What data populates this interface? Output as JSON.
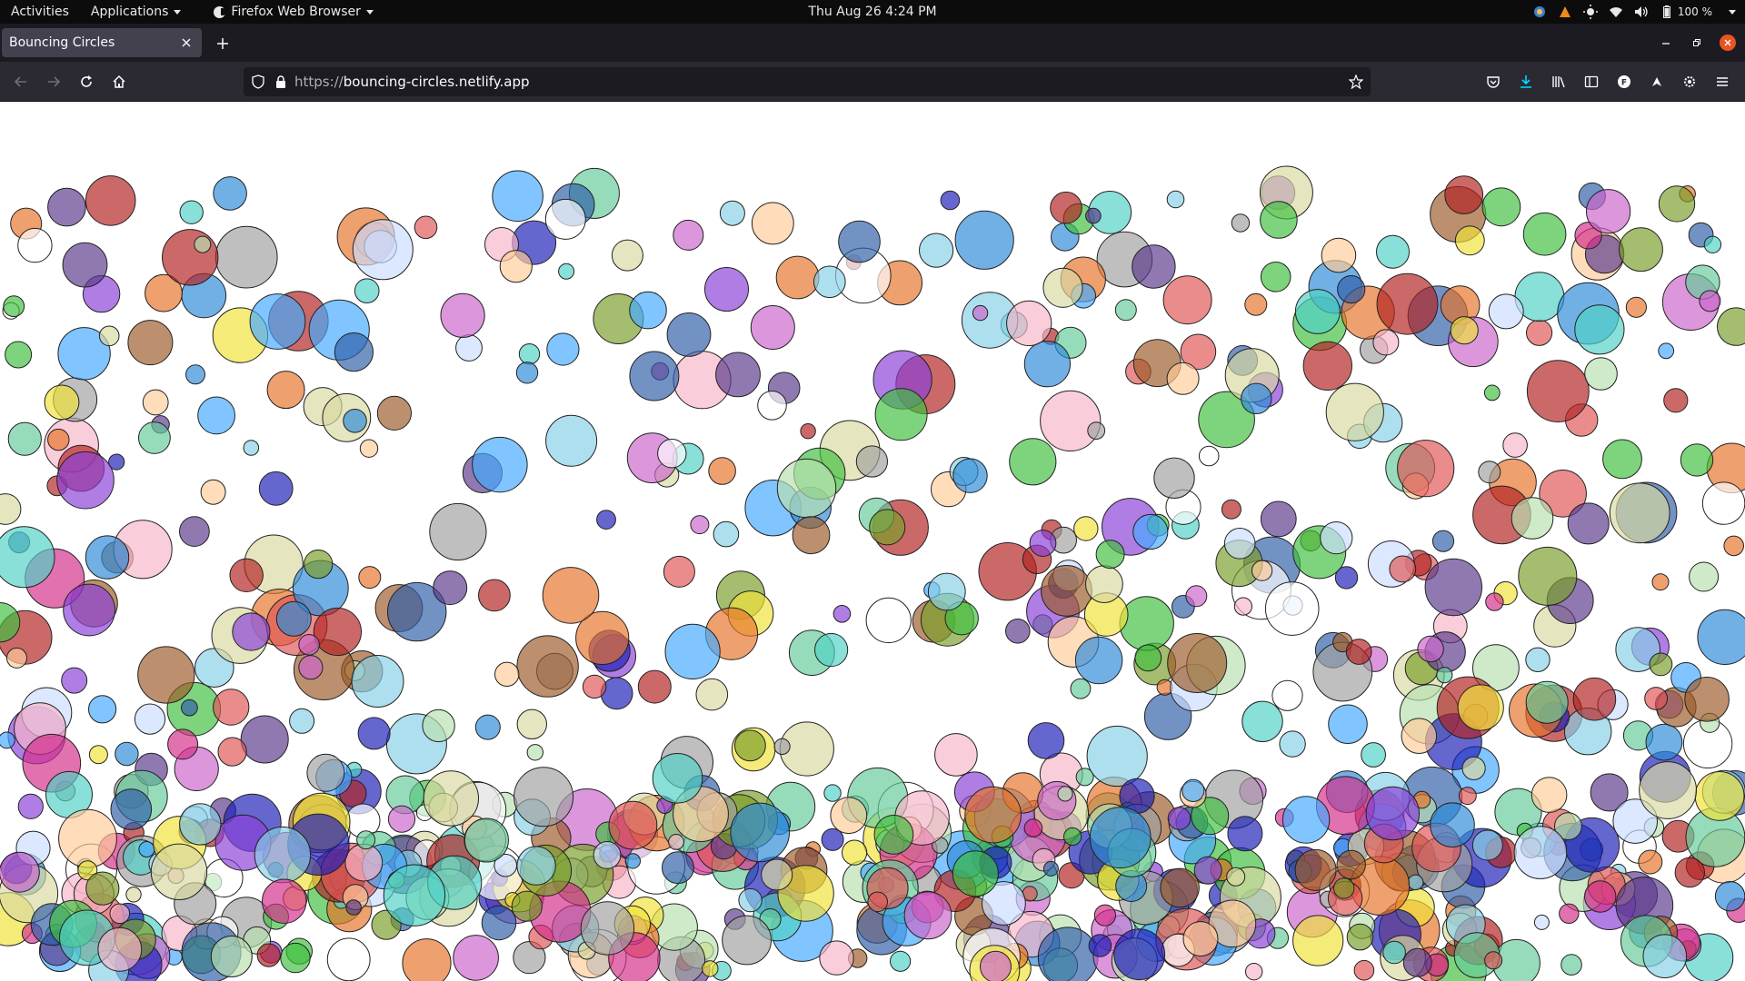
{
  "topbar": {
    "activities": "Activities",
    "applications": "Applications",
    "browser_app": "Firefox Web Browser",
    "clock": "Thu Aug 26   4:24 PM",
    "battery": "100 %"
  },
  "browser": {
    "tab_title": "Bouncing Circles",
    "url_scheme": "https://",
    "url_host": "bouncing-circles.netlify.app"
  },
  "icons": {
    "back": "back-arrow-icon",
    "forward": "forward-arrow-icon",
    "reload": "reload-icon",
    "home": "home-icon",
    "shield": "tracking-shield-icon",
    "lock": "lock-icon",
    "bookmark": "bookmark-star-icon",
    "pocket": "pocket-icon",
    "downloads": "downloads-icon",
    "library": "library-icon",
    "sidebar": "sidebar-icon",
    "account": "account-icon",
    "extension1": "extension-icon",
    "extension2": "extension-gear-icon",
    "menu": "hamburger-menu-icon"
  },
  "colors": {
    "accent_close": "#e95420",
    "download_blue": "#00ddff"
  },
  "canvas": {
    "circle_count": 900,
    "seed": 7,
    "fill_opacity": 0.68,
    "palette": [
      "#2d8ad8",
      "#3fbf3f",
      "#d42d8b",
      "#e6732a",
      "#8b3fd8",
      "#4fd1c5",
      "#f0e23a",
      "#a0a0a0",
      "#7a9e2a",
      "#e05555",
      "#1d1db8",
      "#9c5c2a",
      "#66cc99",
      "#cc66cc",
      "#44aaff",
      "#ffcc99",
      "#ccddff",
      "#ffffff",
      "#b8e0b0",
      "#f7b6c8",
      "#5b3a8c",
      "#2f5fa8",
      "#b22222",
      "#88d0e8",
      "#d9d9a0"
    ]
  }
}
